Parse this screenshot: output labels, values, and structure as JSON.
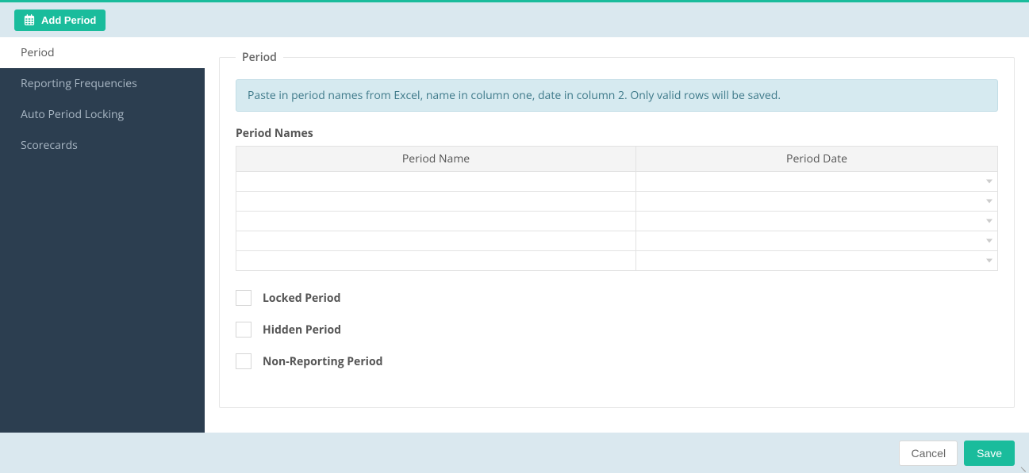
{
  "topbar": {
    "add_period_label": "Add Period"
  },
  "sidebar": {
    "items": [
      {
        "label": "Period",
        "active": true
      },
      {
        "label": "Reporting Frequencies",
        "active": false
      },
      {
        "label": "Auto Period Locking",
        "active": false
      },
      {
        "label": "Scorecards",
        "active": false
      }
    ]
  },
  "panel": {
    "legend": "Period",
    "info_text": "Paste in period names from Excel, name in column one, date in column 2. Only valid rows will be saved.",
    "table_label": "Period Names",
    "columns": [
      "Period Name",
      "Period Date"
    ],
    "rows": [
      {
        "name": "",
        "date": ""
      },
      {
        "name": "",
        "date": ""
      },
      {
        "name": "",
        "date": ""
      },
      {
        "name": "",
        "date": ""
      },
      {
        "name": "",
        "date": ""
      }
    ],
    "checkboxes": [
      {
        "label": "Locked Period",
        "checked": false
      },
      {
        "label": "Hidden Period",
        "checked": false
      },
      {
        "label": "Non-Reporting Period",
        "checked": false
      }
    ]
  },
  "footer": {
    "cancel_label": "Cancel",
    "save_label": "Save"
  }
}
